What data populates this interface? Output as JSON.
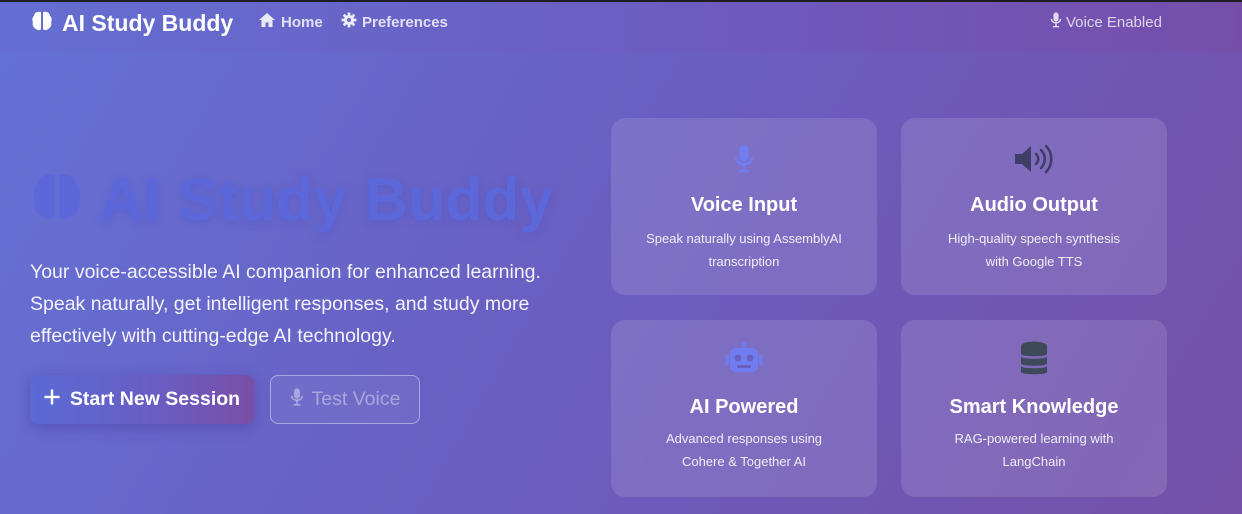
{
  "navbar": {
    "brand": "AI Study Buddy",
    "links": [
      {
        "label": "Home",
        "icon": "home-icon"
      },
      {
        "label": "Preferences",
        "icon": "gear-icon"
      }
    ],
    "status": "Voice Enabled"
  },
  "hero": {
    "title": "AI Study Buddy",
    "description_lines": [
      "Your voice-accessible AI companion for enhanced learning.",
      "Speak naturally, get intelligent responses, and study more",
      "effectively with cutting-edge AI technology."
    ],
    "primary_button": "Start New Session",
    "secondary_button": "Test Voice"
  },
  "features": [
    {
      "icon": "microphone-icon",
      "title": "Voice Input",
      "desc_lines": [
        "Speak naturally using AssemblyAI",
        "transcription"
      ]
    },
    {
      "icon": "speaker-icon",
      "title": "Audio Output",
      "desc_lines": [
        "High-quality speech synthesis",
        "with Google TTS"
      ]
    },
    {
      "icon": "robot-icon",
      "title": "AI Powered",
      "desc_lines": [
        "Advanced responses using",
        "Cohere & Together AI"
      ]
    },
    {
      "icon": "database-icon",
      "title": "Smart Knowledge",
      "desc_lines": [
        "RAG-powered learning with",
        "LangChain"
      ]
    }
  ],
  "colors": {
    "accent": "#5c68da",
    "mic_icon": "#6f7df0",
    "speaker_icon": "#3e3e66",
    "robot_icon": "#6f7df0",
    "database_icon": "#3e4a5a"
  }
}
